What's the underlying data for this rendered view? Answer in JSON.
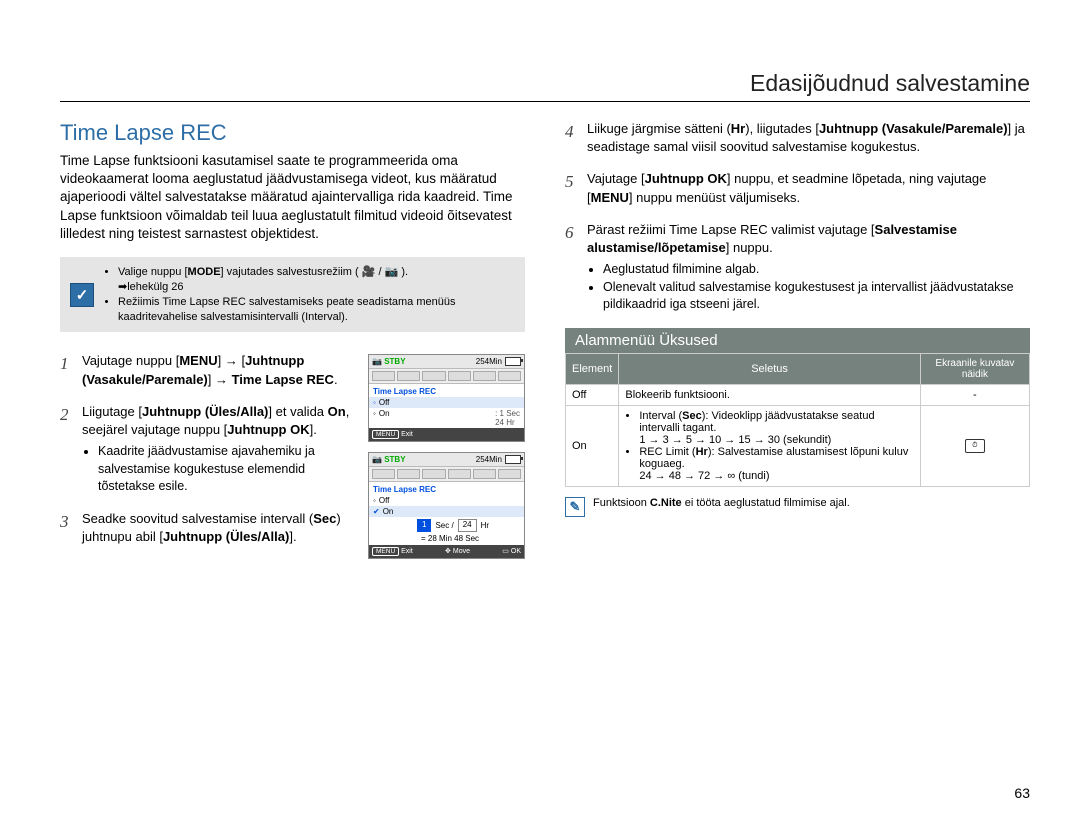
{
  "chapter": "Edasijõudnud salvestamine",
  "section_title": "Time Lapse REC",
  "intro": "Time Lapse funktsiooni kasutamisel saate te programmeerida oma videokaamerat looma aeglustatud jäädvustamisega videot, kus määratud ajaperioodi vältel salvestatakse määratud ajaintervalliga rida kaadreid. Time Lapse funktsioon võimaldab teil luua aeglustatult filmitud videoid õitsevatest lilledest ning teistest sarnastest objektidest.",
  "note1_line1_a": "Valige nuppu [",
  "note1_line1_b": "] vajutades salvestusrežiim ( 🎥 / 📷 ).",
  "note1_line2": "➡lehekülg 26",
  "note1_line3": "Režiimis Time Lapse REC salvestamiseks peate seadistama menüüs kaadritevahelise salvestamisintervalli (Interval).",
  "mode_label": "MODE",
  "steps_left": {
    "s1_a": "Vajutage nuppu [",
    "s1_menu": "MENU",
    "s1_b": "] → [",
    "s1_bold1": "Juhtnupp (Vasakule/Paremale)",
    "s1_c": "] → ",
    "s1_bold2": "Time Lapse REC",
    "s2_a": "Liigutage [",
    "s2_bold1": "Juhtnupp (Üles/Alla)",
    "s2_b": "] et valida ",
    "s2_on": "On",
    "s2_c": ", seejärel vajutage nuppu [",
    "s2_bold2": "Juhtnupp OK",
    "s2_d": "].",
    "s2_bullet": "Kaadrite jäädvustamise ajavahemiku ja salvestamise kogukestuse elemendid tõstetakse esile.",
    "s3_a": "Seadke soovitud salvestamise intervall (",
    "s3_sec": "Sec",
    "s3_b": ") juhtnupu abil [",
    "s3_bold": "Juhtnupp (Üles/Alla)",
    "s3_c": "]."
  },
  "steps_right": {
    "s4_a": "Liikuge järgmise sätteni (",
    "s4_hr": "Hr",
    "s4_b": "), liigutades [",
    "s4_bold": "Juhtnupp (Vasakule/Paremale)",
    "s4_c": "] ja seadistage samal viisil soovitud salvestamise kogukestus.",
    "s5_a": "Vajutage [",
    "s5_bold1": "Juhtnupp OK",
    "s5_b": "] nuppu, et seadmine lõpetada, ning vajutage [",
    "s5_menu": "MENU",
    "s5_c": "] nuppu menüüst väljumiseks.",
    "s6_a": "Pärast režiimi Time Lapse REC valimist vajutage [",
    "s6_bold1": "Salvestamise alustamise/lõpetamise",
    "s6_b": "] nuppu.",
    "s6_bullet1": "Aeglustatud filmimine algab.",
    "s6_bullet2": "Olenevalt valitud salvestamise kogukestusest ja intervallist jäädvustatakse pildikaadrid iga stseeni järel."
  },
  "ui1": {
    "stby": "STBY",
    "time": "254Min",
    "title": "Time Lapse REC",
    "off": "Off",
    "on": "On",
    "sec": ": 1 Sec",
    "hr": "  24 Hr",
    "exit_btn": "MENU",
    "exit": "Exit"
  },
  "ui2": {
    "stby": "STBY",
    "time": "254Min",
    "title": "Time Lapse REC",
    "off": "Off",
    "on": "On",
    "sec_val": "1",
    "sec_lbl": "Sec  /",
    "hr_val": "24",
    "hr_lbl": "Hr",
    "calc": "= 28 Min 48 Sec",
    "exit_btn": "MENU",
    "exit": "Exit",
    "move": "Move",
    "ok": "OK"
  },
  "sub_heading": "Alammenüü Üksused",
  "table": {
    "h1": "Element",
    "h2": "Seletus",
    "h3": "Ekraanile kuvatav näidik",
    "r1c1": "Off",
    "r1c2": "Blokeerib funktsiooni.",
    "r1c3": "-",
    "r2c1": "On",
    "r2c2_l1_a": "Interval (",
    "r2c2_l1_sec": "Sec",
    "r2c2_l1_b": "): Videoklipp jäädvustatakse seatud intervalli tagant.",
    "r2c2_l2": "1 → 3 → 5 → 10 → 15 → 30 (sekundit)",
    "r2c2_l3_a": "REC Limit (",
    "r2c2_l3_hr": "Hr",
    "r2c2_l3_b": "): Salvestamise alustamisest lõpuni kuluv koguaeg.",
    "r2c2_l4": "24 → 48 → 72 → ∞ (tundi)"
  },
  "footnote_a": "Funktsioon ",
  "footnote_bold": "C.Nite",
  "footnote_b": " ei tööta aeglustatud filmimise ajal.",
  "page_num": "63"
}
